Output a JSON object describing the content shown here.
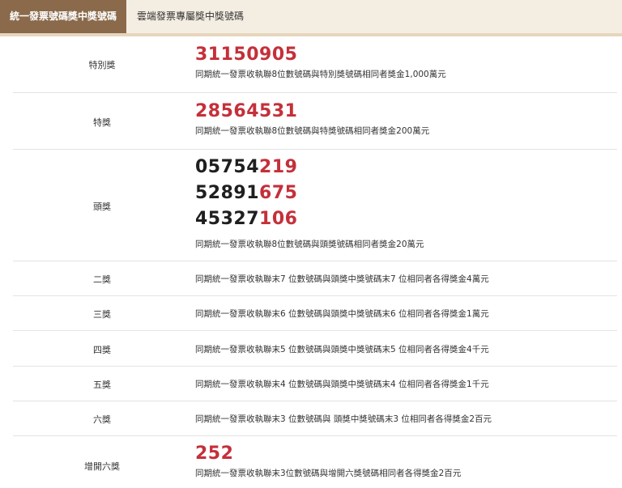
{
  "tabs": [
    {
      "label": "統一發票號碼獎中獎號碼",
      "active": true
    },
    {
      "label": "雲端發票專屬獎中獎號碼",
      "active": false
    }
  ],
  "colors": {
    "accent": "#8a6a4b",
    "tabbar_bg": "#f4ede2",
    "winning_red": "#c4303a"
  },
  "prizes": {
    "special": {
      "label": "特別獎",
      "number": "31150905",
      "description": "同期統一發票收執聯8位數號碼與特別獎號碼相同者獎金1,000萬元"
    },
    "grand": {
      "label": "特獎",
      "number": "28564531",
      "description": "同期統一發票收執聯8位數號碼與特獎號碼相同者獎金200萬元"
    },
    "first": {
      "label": "頭獎",
      "numbers": [
        {
          "prefix": "05754",
          "suffix": "219"
        },
        {
          "prefix": "52891",
          "suffix": "675"
        },
        {
          "prefix": "45327",
          "suffix": "106"
        }
      ],
      "description": "同期統一發票收執聯8位數號碼與頭獎號碼相同者獎金20萬元"
    },
    "second": {
      "label": "二獎",
      "description": "同期統一發票收執聯末7 位數號碼與頭獎中獎號碼末7 位相同者各得獎金4萬元"
    },
    "third": {
      "label": "三獎",
      "description": "同期統一發票收執聯末6 位數號碼與頭獎中獎號碼末6 位相同者各得獎金1萬元"
    },
    "fourth": {
      "label": "四獎",
      "description": "同期統一發票收執聯末5 位數號碼與頭獎中獎號碼末5 位相同者各得獎金4千元"
    },
    "fifth": {
      "label": "五獎",
      "description": "同期統一發票收執聯末4 位數號碼與頭獎中獎號碼末4 位相同者各得獎金1千元"
    },
    "sixth": {
      "label": "六獎",
      "description": "同期統一發票收執聯末3 位數號碼與 頭獎中獎號碼末3 位相同者各得獎金2百元"
    },
    "additional_sixth": {
      "label": "增開六獎",
      "number": "252",
      "description": "同期統一發票收執聯末3位數號碼與增開六獎號碼相同者各得獎金2百元"
    }
  }
}
